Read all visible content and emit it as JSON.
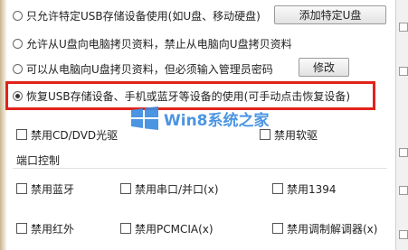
{
  "options": {
    "radio1": "只允许特定USB存储设备使用(如U盘、移动硬盘)",
    "add_button": "添加特定U盘",
    "radio2": "允许从U盘向电脑拷贝资料，禁止从电脑向U盘拷贝资料",
    "radio3": "可以从电脑向U盘拷贝资料，但必须输入管理员密码",
    "modify_button": "修改",
    "radio4": "恢复USB存储设备、手机或蓝牙等设备的使用(可手动点击恢复设备)"
  },
  "checkboxes_top": {
    "cd_dvd": "禁用CD/DVD光驱",
    "floppy": "禁用软驱"
  },
  "port_control": {
    "heading": "端口控制",
    "bluetooth": "禁用蓝牙",
    "serial_parallel": "禁用串口/并口(x)",
    "ieee1394": "禁用1394",
    "infrared": "禁用红外",
    "pcmcia": "禁用PCMCIA(x)",
    "modem": "禁用调制解调器(x)"
  },
  "watermark": "Win8系统之家",
  "colors": {
    "highlight_border": "#e0231b",
    "watermark_blue": "#3c8de0"
  }
}
